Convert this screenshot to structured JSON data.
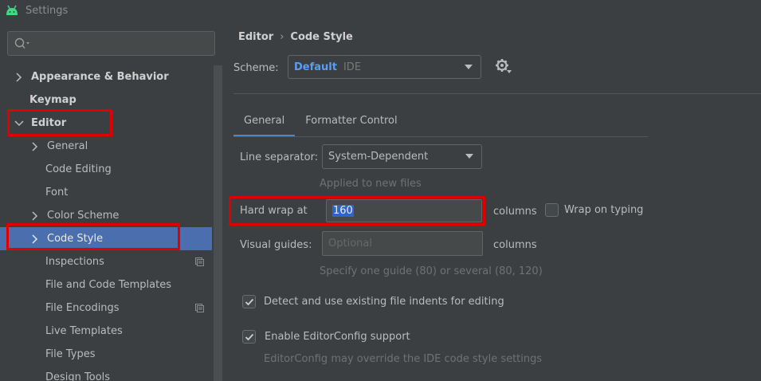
{
  "window": {
    "title": "Settings"
  },
  "search": {
    "placeholder": ""
  },
  "sidebar": {
    "items": [
      {
        "label": "Appearance & Behavior"
      },
      {
        "label": "Keymap"
      },
      {
        "label": "Editor"
      },
      {
        "label": "General"
      },
      {
        "label": "Code Editing"
      },
      {
        "label": "Font"
      },
      {
        "label": "Color Scheme"
      },
      {
        "label": "Code Style"
      },
      {
        "label": "Inspections"
      },
      {
        "label": "File and Code Templates"
      },
      {
        "label": "File Encodings"
      },
      {
        "label": "Live Templates"
      },
      {
        "label": "File Types"
      },
      {
        "label": "Design Tools"
      }
    ]
  },
  "breadcrumb": {
    "parent": "Editor",
    "separator": "›",
    "current": "Code Style"
  },
  "scheme": {
    "label": "Scheme:",
    "value": "Default",
    "sub": "IDE"
  },
  "tabs": [
    {
      "label": "General"
    },
    {
      "label": "Formatter Control"
    }
  ],
  "general": {
    "line_separator_label": "Line separator:",
    "line_separator_value": "System-Dependent",
    "line_separator_hint": "Applied to new files",
    "hard_wrap_label": "Hard wrap at",
    "hard_wrap_value": "160",
    "columns_1": "columns",
    "wrap_on_typing_label": "Wrap on typing",
    "visual_guides_label": "Visual guides:",
    "visual_guides_placeholder": "Optional",
    "columns_2": "columns",
    "visual_guides_hint": "Specify one guide (80) or several (80, 120)",
    "detect_indents_label": "Detect and use existing file indents for editing",
    "editorconfig_label": "Enable EditorConfig support",
    "editorconfig_hint": "EditorConfig may override the IDE code style settings"
  },
  "colors": {
    "accent": "#4b6eaf",
    "highlight_box": "#e00000",
    "scheme_value": "#589df6"
  }
}
